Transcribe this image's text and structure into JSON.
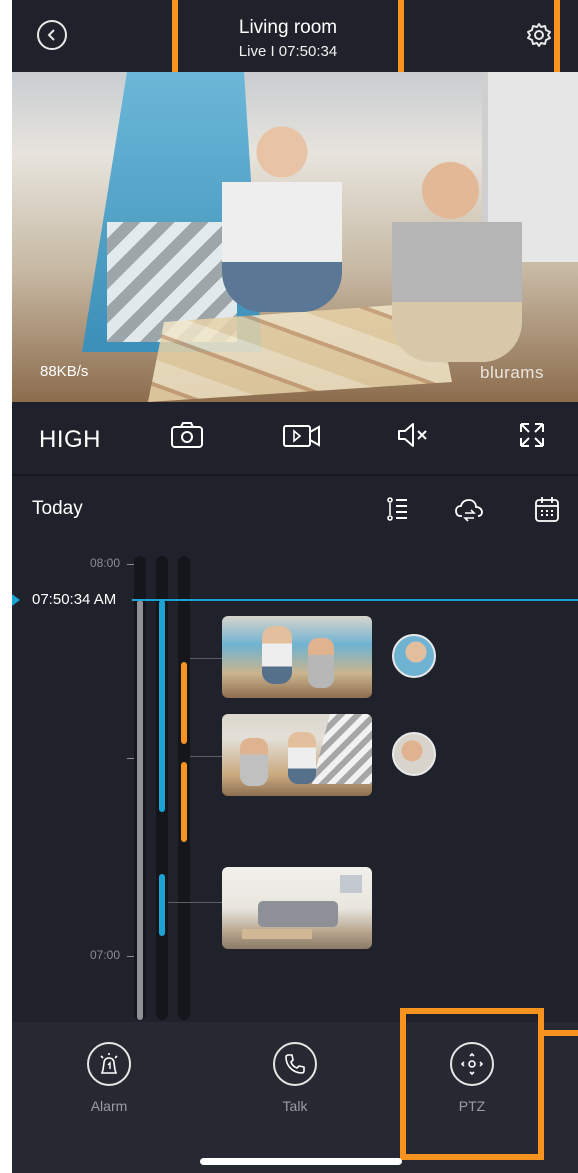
{
  "header": {
    "title": "Living room",
    "subtitle": "Live I 07:50:34"
  },
  "video": {
    "bitrate": "88KB/s",
    "watermark": "blurams"
  },
  "controls": {
    "quality": "HIGH",
    "icons": [
      "camera-icon",
      "record-video-icon",
      "mute-icon",
      "fullscreen-icon"
    ]
  },
  "timeline": {
    "day_label": "Today",
    "icons": [
      "filter-list-icon",
      "cloud-sync-icon",
      "calendar-icon"
    ],
    "ticks": [
      {
        "label": "08:00"
      },
      {
        "label": "07:00"
      }
    ],
    "current_time": "07:50:34 AM"
  },
  "bottom_nav": [
    {
      "label": "Alarm",
      "icon": "alarm-icon"
    },
    {
      "label": "Talk",
      "icon": "phone-icon"
    },
    {
      "label": "PTZ",
      "icon": "ptz-icon"
    }
  ],
  "colors": {
    "accent": "#1aa3d3",
    "event": "#f7931e",
    "annotation": "#f7931e",
    "background": "#1f222a"
  }
}
